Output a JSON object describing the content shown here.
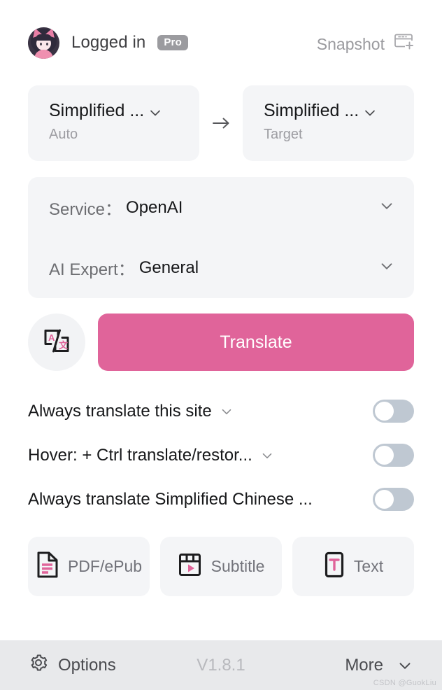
{
  "header": {
    "avatar_alt": "user-avatar",
    "status_label": "Logged in",
    "plan_badge": "Pro",
    "snapshot_label": "Snapshot"
  },
  "languages": {
    "source": {
      "name": "Simplified ...",
      "sub": "Auto"
    },
    "target": {
      "name": "Simplified ...",
      "sub": "Target"
    },
    "direction_icon": "arrow-right-icon"
  },
  "service": {
    "service_label": "Service：",
    "service_value": "OpenAI",
    "expert_label": "AI Expert：",
    "expert_value": "General"
  },
  "actions": {
    "translate_icon": "translate-icon",
    "translate_label": "Translate"
  },
  "toggles": [
    {
      "label": "Always translate this site",
      "has_chevron": true,
      "state": "off"
    },
    {
      "label": "Hover:  + Ctrl translate/restor...",
      "has_chevron": true,
      "state": "off"
    },
    {
      "label": "Always translate Simplified Chinese ...",
      "has_chevron": false,
      "state": "off"
    }
  ],
  "features": [
    {
      "label": "PDF/ePub",
      "icon": "document-icon"
    },
    {
      "label": "Subtitle",
      "icon": "video-subtitle-icon"
    },
    {
      "label": "Text",
      "icon": "text-icon"
    }
  ],
  "footer": {
    "options_label": "Options",
    "options_icon": "gear-icon",
    "version": "V1.8.1",
    "more_label": "More",
    "watermark": "CSDN @GuokLiu"
  },
  "colors": {
    "accent_pink": "#e0649a",
    "card_bg": "#f4f5f7",
    "footer_bg": "#e8e9eb",
    "toggle_off": "#bfc8d2",
    "badge_gray": "#9b9b9f"
  }
}
